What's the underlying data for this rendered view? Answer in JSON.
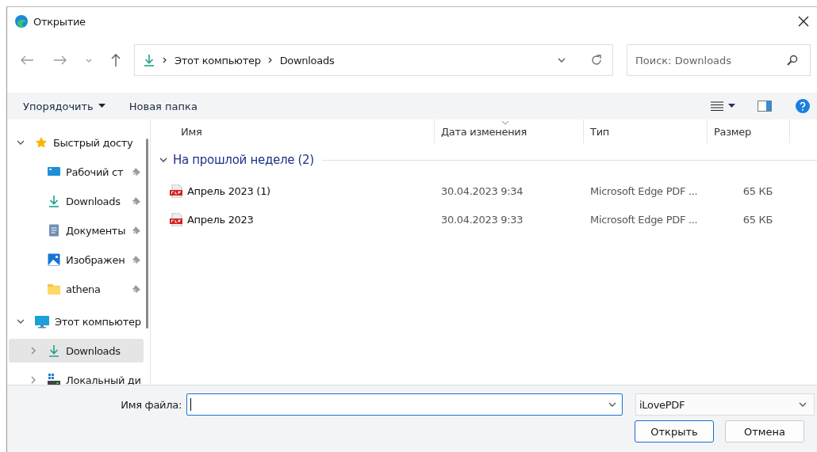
{
  "window": {
    "title": "Открытие"
  },
  "address": {
    "crumbs": [
      "Этот компьютер",
      "Downloads"
    ]
  },
  "search": {
    "placeholder": "Поиск: Downloads"
  },
  "toolbar": {
    "buttons": [
      {
        "label": "Упорядочить",
        "dropdown": true
      },
      {
        "label": "Новая папка",
        "dropdown": false
      }
    ]
  },
  "sidebar": {
    "items": [
      {
        "label": "Быстрый досту",
        "kind": "star",
        "expanded": true,
        "selected": false,
        "children": [
          {
            "label": "Рабочий ст",
            "kind": "desktop",
            "pinned": true,
            "selected": false
          },
          {
            "label": "Downloads",
            "kind": "download",
            "pinned": true,
            "selected": false
          },
          {
            "label": "Документы",
            "kind": "document",
            "pinned": true,
            "selected": false
          },
          {
            "label": "Изображен",
            "kind": "pictures",
            "pinned": true,
            "selected": false
          },
          {
            "label": "athena",
            "kind": "folder",
            "pinned": true,
            "selected": false
          }
        ]
      },
      {
        "label": "Этот компьютер",
        "kind": "pc",
        "expanded": true,
        "selected": false,
        "children": [
          {
            "label": "Downloads",
            "kind": "download",
            "expanded": false,
            "selected": true
          },
          {
            "label": "Локальный ди",
            "kind": "drive",
            "expanded": false,
            "selected": false
          }
        ]
      }
    ]
  },
  "table": {
    "columns": [
      {
        "label": "Имя",
        "sorted": false
      },
      {
        "label": "Дата изменения",
        "sorted": true
      },
      {
        "label": "Тип",
        "sorted": false
      },
      {
        "label": "Размер",
        "sorted": false
      }
    ],
    "groups": [
      {
        "title": "На прошлой неделе (2)",
        "expanded": true,
        "rows": [
          {
            "name": "Апрель 2023 (1)",
            "date": "30.04.2023 9:34",
            "type": "Microsoft Edge PDF ...",
            "size": "65 КБ"
          },
          {
            "name": "Апрель 2023",
            "date": "30.04.2023 9:33",
            "type": "Microsoft Edge PDF ...",
            "size": "65 КБ"
          }
        ]
      }
    ]
  },
  "footer": {
    "filename_label": "Имя файла:",
    "filter": "iLovePDF",
    "buttons": [
      {
        "label": "Открыть",
        "default": true
      },
      {
        "label": "Отмена",
        "default": false
      }
    ]
  }
}
